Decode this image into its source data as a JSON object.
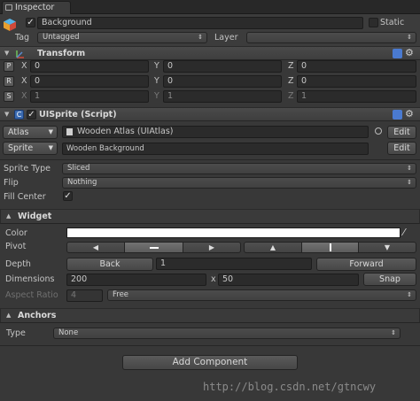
{
  "tab": {
    "label": "Inspector"
  },
  "object": {
    "name": "Background",
    "static_label": "Static",
    "tag_label": "Tag",
    "tag_value": "Untagged",
    "layer_label": "Layer",
    "layer_value": ""
  },
  "transform": {
    "title": "Transform",
    "rows": [
      {
        "btn": "P",
        "x": "0",
        "y": "0",
        "z": "0"
      },
      {
        "btn": "R",
        "x": "0",
        "y": "0",
        "z": "0"
      },
      {
        "btn": "S",
        "x": "1",
        "y": "1",
        "z": "1"
      }
    ],
    "axis_x": "X",
    "axis_y": "Y",
    "axis_z": "Z"
  },
  "uisprite": {
    "title": "UISprite (Script)",
    "atlas_btn": "Atlas",
    "atlas_value": "Wooden Atlas (UIAtlas)",
    "sprite_btn": "Sprite",
    "sprite_value": "Wooden Background",
    "edit_label": "Edit",
    "sprite_type_label": "Sprite Type",
    "sprite_type_value": "Sliced",
    "flip_label": "Flip",
    "flip_value": "Nothing",
    "fill_center_label": "Fill Center"
  },
  "widget": {
    "title": "Widget",
    "color_label": "Color",
    "color_value": "#ffffff",
    "pivot_label": "Pivot",
    "depth_label": "Depth",
    "back_label": "Back",
    "depth_value": "1",
    "forward_label": "Forward",
    "dimensions_label": "Dimensions",
    "width": "200",
    "x_sep": "x",
    "height": "50",
    "snap_label": "Snap",
    "aspect_label": "Aspect Ratio",
    "aspect_value": "4",
    "aspect_mode": "Free"
  },
  "anchors": {
    "title": "Anchors",
    "type_label": "Type",
    "type_value": "None"
  },
  "add_component": "Add Component",
  "watermark": "http://blog.csdn.net/gtncwy",
  "colors": {
    "panel": "#383838",
    "field": "#2b2b2b",
    "accent": "#4a7ad0"
  }
}
